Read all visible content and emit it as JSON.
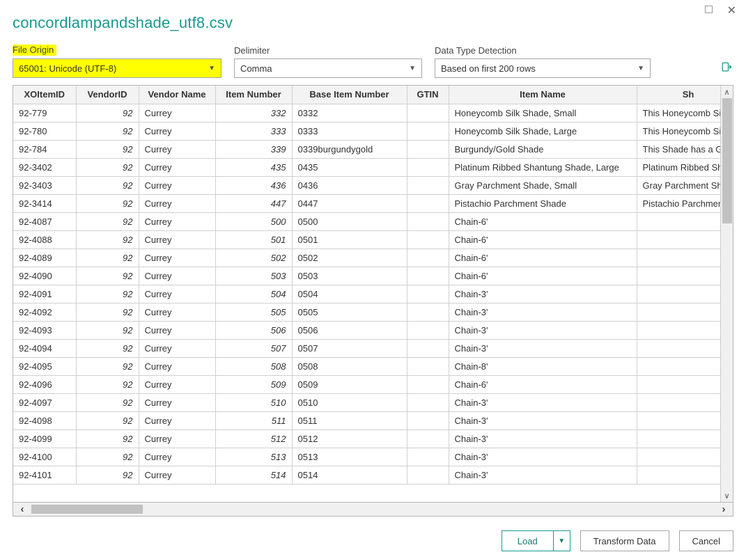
{
  "title": "concordlampandshade_utf8.csv",
  "controls": {
    "file_origin_label": "File Origin",
    "file_origin_value": "65001: Unicode (UTF-8)",
    "delimiter_label": "Delimiter",
    "delimiter_value": "Comma",
    "detection_label": "Data Type Detection",
    "detection_value": "Based on first 200 rows"
  },
  "columns": {
    "xo": "XOItemID",
    "vid": "VendorID",
    "vname": "Vendor Name",
    "itemnum": "Item Number",
    "base": "Base Item Number",
    "gtin": "GTIN",
    "itemname": "Item Name",
    "sh": "Sh"
  },
  "rows": [
    {
      "xo": "92-779",
      "vid": "92",
      "vname": "Currey",
      "inum": "332",
      "base": "0332",
      "gtin": "",
      "iname": "Honeycomb Silk Shade, Small",
      "sh": "This Honeycomb Sil"
    },
    {
      "xo": "92-780",
      "vid": "92",
      "vname": "Currey",
      "inum": "333",
      "base": "0333",
      "gtin": "",
      "iname": "Honeycomb Silk Shade, Large",
      "sh": "This Honeycomb Sil"
    },
    {
      "xo": "92-784",
      "vid": "92",
      "vname": "Currey",
      "inum": "339",
      "base": "0339burgundygold",
      "gtin": "",
      "iname": "Burgundy/Gold Shade",
      "sh": "This Shade has a Gc"
    },
    {
      "xo": "92-3402",
      "vid": "92",
      "vname": "Currey",
      "inum": "435",
      "base": "0435",
      "gtin": "",
      "iname": "Platinum Ribbed Shantung Shade, Large",
      "sh": "Platinum Ribbed Sh"
    },
    {
      "xo": "92-3403",
      "vid": "92",
      "vname": "Currey",
      "inum": "436",
      "base": "0436",
      "gtin": "",
      "iname": "Gray Parchment Shade, Small",
      "sh": "Gray Parchment Sh"
    },
    {
      "xo": "92-3414",
      "vid": "92",
      "vname": "Currey",
      "inum": "447",
      "base": "0447",
      "gtin": "",
      "iname": "Pistachio Parchment Shade",
      "sh": "Pistachio Parchmen"
    },
    {
      "xo": "92-4087",
      "vid": "92",
      "vname": "Currey",
      "inum": "500",
      "base": "0500",
      "gtin": "",
      "iname": "Chain-6'",
      "sh": ""
    },
    {
      "xo": "92-4088",
      "vid": "92",
      "vname": "Currey",
      "inum": "501",
      "base": "0501",
      "gtin": "",
      "iname": "Chain-6'",
      "sh": ""
    },
    {
      "xo": "92-4089",
      "vid": "92",
      "vname": "Currey",
      "inum": "502",
      "base": "0502",
      "gtin": "",
      "iname": "Chain-6'",
      "sh": ""
    },
    {
      "xo": "92-4090",
      "vid": "92",
      "vname": "Currey",
      "inum": "503",
      "base": "0503",
      "gtin": "",
      "iname": "Chain-6'",
      "sh": ""
    },
    {
      "xo": "92-4091",
      "vid": "92",
      "vname": "Currey",
      "inum": "504",
      "base": "0504",
      "gtin": "",
      "iname": "Chain-3'",
      "sh": ""
    },
    {
      "xo": "92-4092",
      "vid": "92",
      "vname": "Currey",
      "inum": "505",
      "base": "0505",
      "gtin": "",
      "iname": "Chain-3'",
      "sh": ""
    },
    {
      "xo": "92-4093",
      "vid": "92",
      "vname": "Currey",
      "inum": "506",
      "base": "0506",
      "gtin": "",
      "iname": "Chain-3'",
      "sh": ""
    },
    {
      "xo": "92-4094",
      "vid": "92",
      "vname": "Currey",
      "inum": "507",
      "base": "0507",
      "gtin": "",
      "iname": "Chain-3'",
      "sh": ""
    },
    {
      "xo": "92-4095",
      "vid": "92",
      "vname": "Currey",
      "inum": "508",
      "base": "0508",
      "gtin": "",
      "iname": "Chain-8'",
      "sh": ""
    },
    {
      "xo": "92-4096",
      "vid": "92",
      "vname": "Currey",
      "inum": "509",
      "base": "0509",
      "gtin": "",
      "iname": "Chain-6'",
      "sh": ""
    },
    {
      "xo": "92-4097",
      "vid": "92",
      "vname": "Currey",
      "inum": "510",
      "base": "0510",
      "gtin": "",
      "iname": "Chain-3'",
      "sh": ""
    },
    {
      "xo": "92-4098",
      "vid": "92",
      "vname": "Currey",
      "inum": "511",
      "base": "0511",
      "gtin": "",
      "iname": "Chain-3'",
      "sh": ""
    },
    {
      "xo": "92-4099",
      "vid": "92",
      "vname": "Currey",
      "inum": "512",
      "base": "0512",
      "gtin": "",
      "iname": "Chain-3'",
      "sh": ""
    },
    {
      "xo": "92-4100",
      "vid": "92",
      "vname": "Currey",
      "inum": "513",
      "base": "0513",
      "gtin": "",
      "iname": "Chain-3'",
      "sh": ""
    },
    {
      "xo": "92-4101",
      "vid": "92",
      "vname": "Currey",
      "inum": "514",
      "base": "0514",
      "gtin": "",
      "iname": "Chain-3'",
      "sh": ""
    }
  ],
  "buttons": {
    "load": "Load",
    "transform": "Transform Data",
    "cancel": "Cancel"
  }
}
